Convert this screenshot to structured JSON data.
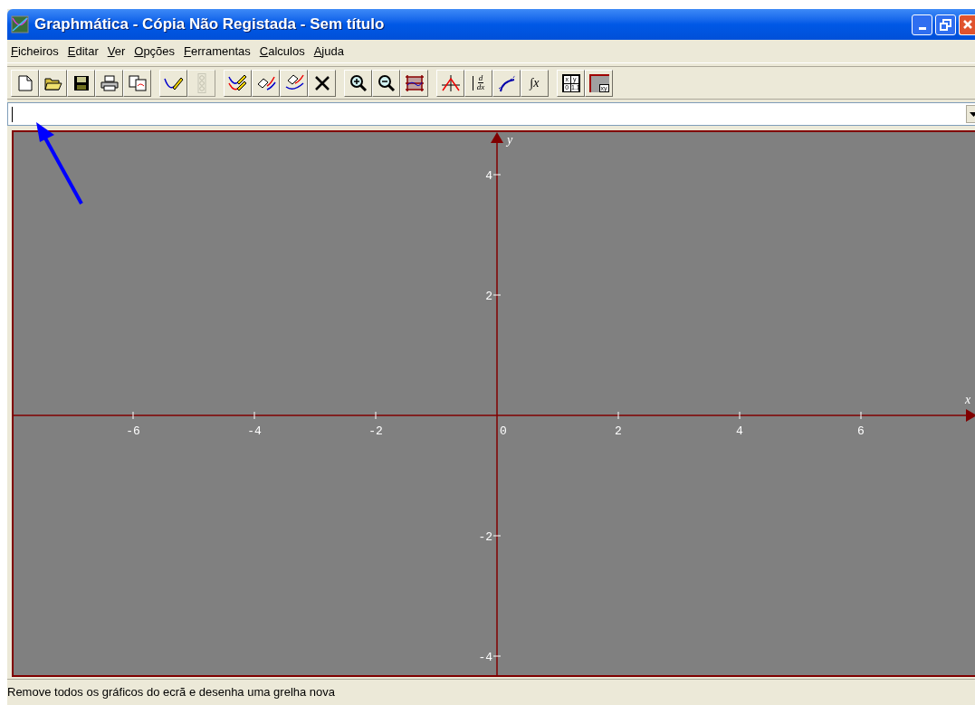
{
  "window": {
    "title": "Graphmática - Cópia Não Registada - Sem título"
  },
  "menu": [
    {
      "label": "Ficheiros"
    },
    {
      "label": "Editar"
    },
    {
      "label": "Ver"
    },
    {
      "label": "Opções"
    },
    {
      "label": "Ferramentas"
    },
    {
      "label": "Calculos"
    },
    {
      "label": "Ajuda"
    }
  ],
  "toolbar": [
    [
      {
        "kind": "new",
        "disabled": false
      },
      {
        "kind": "open",
        "disabled": false
      },
      {
        "kind": "save",
        "disabled": false
      },
      {
        "kind": "print",
        "disabled": false
      },
      {
        "kind": "copy",
        "disabled": false
      }
    ],
    [
      {
        "kind": "pen",
        "disabled": false
      },
      {
        "kind": "points",
        "disabled": true
      }
    ],
    [
      {
        "kind": "pens",
        "disabled": false
      },
      {
        "kind": "eraser",
        "disabled": false
      },
      {
        "kind": "eraser2",
        "disabled": false
      },
      {
        "kind": "delete",
        "disabled": false
      }
    ],
    [
      {
        "kind": "zoom_in",
        "disabled": false
      },
      {
        "kind": "zoom_out",
        "disabled": false
      },
      {
        "kind": "grid",
        "disabled": false
      }
    ],
    [
      {
        "kind": "roots",
        "disabled": false
      },
      {
        "kind": "derivative",
        "disabled": false,
        "labels": [
          "d",
          "dx"
        ]
      },
      {
        "kind": "tangent",
        "disabled": false
      },
      {
        "kind": "integral",
        "disabled": false,
        "labels": [
          "∫x"
        ]
      }
    ],
    [
      {
        "kind": "table",
        "disabled": false,
        "labels": [
          "x",
          "y",
          "0",
          "1.1"
        ]
      },
      {
        "kind": "coords",
        "disabled": false,
        "labels": [
          "xy"
        ]
      }
    ]
  ],
  "graph": {
    "x_axis_label": "x",
    "y_axis_label": "y",
    "origin_label": "0",
    "x_ticks": [
      "-6",
      "-4",
      "-2",
      "2",
      "4",
      "6"
    ],
    "y_ticks": [
      "4",
      "2",
      "-2",
      "-4"
    ]
  },
  "status_bar": "Remove todos os gráficos do ecrã e desenha uma grelha nova"
}
